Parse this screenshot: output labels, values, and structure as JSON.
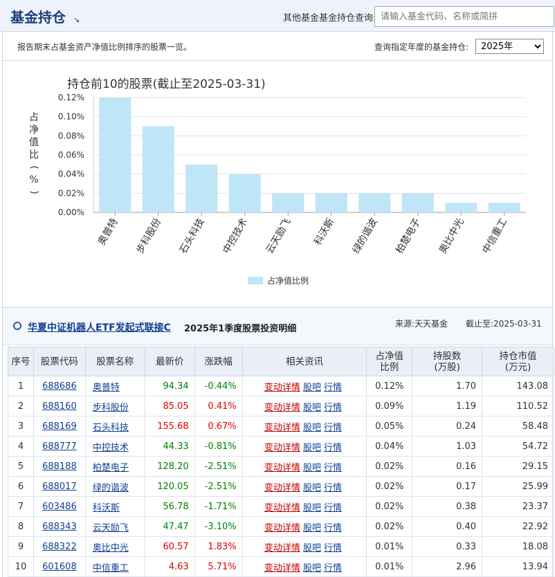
{
  "header": {
    "title": "基金持仓",
    "title_arrow": "↘",
    "query_label": "其他基金基金持仓查询:",
    "search_placeholder": "请输入基金代码、名称或简拼"
  },
  "panel": {
    "description": "报告期末占基金资产净值比例排序的股票一览。",
    "year_label": "查询指定年度的基金持仓:",
    "year_value": "2025年"
  },
  "chart_data": {
    "type": "bar",
    "title": "持仓前10的股票(截止至2025-03-31)",
    "ylabel": "占净值比(%)",
    "categories": [
      "奥普特",
      "步科股份",
      "石头科技",
      "中控技术",
      "云天励飞",
      "科沃斯",
      "绿的谐波",
      "柏楚电子",
      "奥比中光",
      "中信重工"
    ],
    "values": [
      0.12,
      0.09,
      0.05,
      0.04,
      0.02,
      0.02,
      0.02,
      0.02,
      0.01,
      0.01
    ],
    "yticks": [
      "0.00%",
      "0.02%",
      "0.04%",
      "0.06%",
      "0.08%",
      "0.10%",
      "0.12%"
    ],
    "ylim": [
      0,
      0.12
    ],
    "legend": "占净值比例",
    "legend_position": "bottom-center",
    "grid": true,
    "bar_color": "#bfe6f6"
  },
  "detail": {
    "fund_name": "华夏中证机器人ETF发起式联接C",
    "period": "2025年1季度股票投资明细",
    "source": "来源:天天基金",
    "as_of": "截止至:2025-03-31",
    "headers": [
      "序号",
      "股票代码",
      "股票名称",
      "最新价",
      "涨跌幅",
      "相关资讯",
      "占净值比例",
      "持股数(万股)",
      "持仓市值(万元)"
    ],
    "header_lines": [
      [
        "序号"
      ],
      [
        "股票代码"
      ],
      [
        "股票名称"
      ],
      [
        "最新价"
      ],
      [
        "涨跌幅"
      ],
      [
        "相关资讯"
      ],
      [
        "占净值",
        "比例"
      ],
      [
        "持股数",
        "(万股)"
      ],
      [
        "持仓市值",
        "(万元)"
      ]
    ],
    "links": [
      "变动详情",
      "股吧",
      "行情"
    ],
    "rows": [
      {
        "no": "1",
        "code": "688686",
        "name": "奥普特",
        "price": "94.34",
        "change": "-0.44%",
        "dir": "down",
        "ratio": "0.12%",
        "shares": "1.70",
        "value": "143.08"
      },
      {
        "no": "2",
        "code": "688160",
        "name": "步科股份",
        "price": "85.05",
        "change": "0.41%",
        "dir": "up",
        "ratio": "0.09%",
        "shares": "1.19",
        "value": "110.52"
      },
      {
        "no": "3",
        "code": "688169",
        "name": "石头科技",
        "price": "155.68",
        "change": "0.67%",
        "dir": "up",
        "ratio": "0.05%",
        "shares": "0.24",
        "value": "58.48"
      },
      {
        "no": "4",
        "code": "688777",
        "name": "中控技术",
        "price": "44.33",
        "change": "-0.81%",
        "dir": "down",
        "ratio": "0.04%",
        "shares": "1.03",
        "value": "54.72"
      },
      {
        "no": "5",
        "code": "688188",
        "name": "柏楚电子",
        "price": "128.20",
        "change": "-2.51%",
        "dir": "down",
        "ratio": "0.02%",
        "shares": "0.16",
        "value": "29.15"
      },
      {
        "no": "6",
        "code": "688017",
        "name": "绿的谐波",
        "price": "120.05",
        "change": "-2.51%",
        "dir": "down",
        "ratio": "0.02%",
        "shares": "0.17",
        "value": "25.99"
      },
      {
        "no": "7",
        "code": "603486",
        "name": "科沃斯",
        "price": "56.78",
        "change": "-1.71%",
        "dir": "down",
        "ratio": "0.02%",
        "shares": "0.38",
        "value": "23.37"
      },
      {
        "no": "8",
        "code": "688343",
        "name": "云天励飞",
        "price": "47.47",
        "change": "-3.10%",
        "dir": "down",
        "ratio": "0.02%",
        "shares": "0.40",
        "value": "22.92"
      },
      {
        "no": "9",
        "code": "688322",
        "name": "奥比中光",
        "price": "60.57",
        "change": "1.83%",
        "dir": "up",
        "ratio": "0.01%",
        "shares": "0.33",
        "value": "18.08"
      },
      {
        "no": "10",
        "code": "601608",
        "name": "中信重工",
        "price": "4.63",
        "change": "5.71%",
        "dir": "up",
        "ratio": "0.01%",
        "shares": "2.96",
        "value": "13.94"
      }
    ]
  }
}
